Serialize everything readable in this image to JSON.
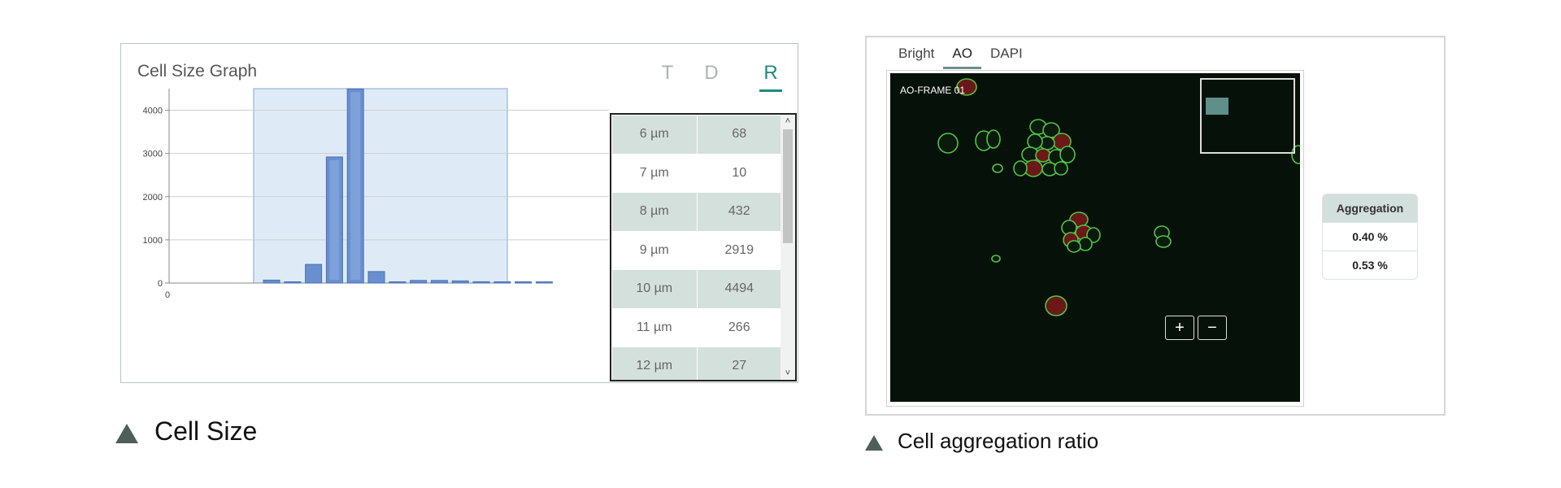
{
  "cell_size": {
    "title": "Cell Size Graph",
    "tabs": [
      "T",
      "D",
      "R"
    ],
    "active_tab": "R",
    "table_rows": [
      {
        "size": "6 µm",
        "count": "68"
      },
      {
        "size": "7 µm",
        "count": "10"
      },
      {
        "size": "8 µm",
        "count": "432"
      },
      {
        "size": "9 µm",
        "count": "2919"
      },
      {
        "size": "10 µm",
        "count": "4494"
      },
      {
        "size": "11 µm",
        "count": "266"
      },
      {
        "size": "12 µm",
        "count": "27"
      }
    ],
    "scroll_up": "˄",
    "scroll_down": "˅"
  },
  "chart_data": {
    "type": "bar",
    "y_ticks": [
      "0",
      "1000",
      "2000",
      "3000",
      "4000"
    ],
    "x_ticks": [
      "0"
    ],
    "ylim": [
      0,
      4500
    ],
    "values": [
      68,
      10,
      432,
      2919,
      4494,
      266,
      27,
      60,
      60,
      50,
      30,
      20,
      15,
      10
    ],
    "grid": true,
    "selection": {
      "from_bar": 0,
      "to_bar": 13
    }
  },
  "captions": {
    "left": "Cell Size",
    "right": "Cell aggregation ratio"
  },
  "image_viewer": {
    "tabs": [
      "Bright",
      "AO",
      "DAPI"
    ],
    "active_tab": "AO",
    "frame_label": "AO-FRAME 01",
    "zoom_in": "+",
    "zoom_out": "−"
  },
  "aggregation": {
    "header": "Aggregation",
    "rows": [
      "0.40 %",
      "0.53 %"
    ]
  },
  "colors": {
    "accent": "#1f8a7a",
    "bar": "#6a8fcf",
    "selection": "#deebf7",
    "cell_outline": "#52c247",
    "cell_fill": "#7a1f1f"
  }
}
